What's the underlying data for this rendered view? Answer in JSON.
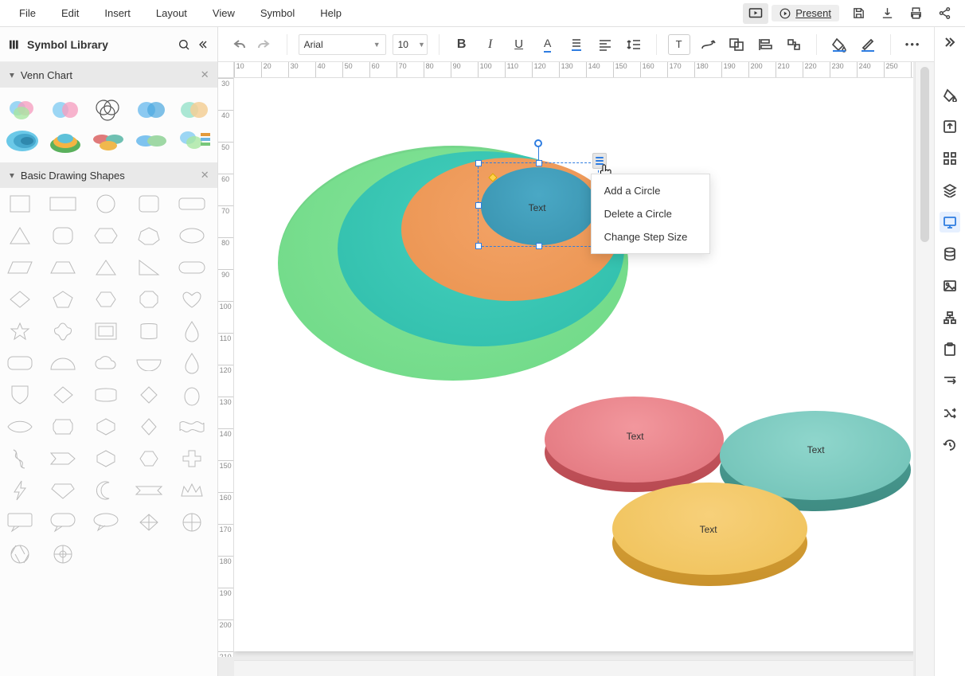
{
  "menu": {
    "items": [
      "File",
      "Edit",
      "Insert",
      "Layout",
      "View",
      "Symbol",
      "Help"
    ]
  },
  "topright": {
    "present": "Present"
  },
  "sidebar": {
    "title": "Symbol Library",
    "sections": {
      "venn": {
        "title": "Venn Chart"
      },
      "basic": {
        "title": "Basic Drawing Shapes"
      }
    }
  },
  "toolbar": {
    "font": "Arial",
    "fontsize": "10"
  },
  "ruler": {
    "h_start": 10,
    "h_step": 10,
    "h_count": 27,
    "v_start": 30,
    "v_step": 10,
    "v_count": 19
  },
  "canvas": {
    "labels": {
      "t1": "Text",
      "t2": "Text",
      "t3": "Text",
      "t4": "Text"
    }
  },
  "context_menu": {
    "items": [
      "Add a Circle",
      "Delete a Circle",
      "Change Step Size"
    ]
  }
}
